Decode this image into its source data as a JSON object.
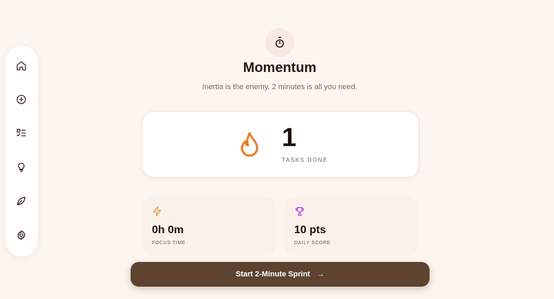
{
  "app": {
    "title": "Momentum",
    "subtitle": "Inertia is the enemy. 2 minutes is all you need."
  },
  "sidebar": {
    "items": [
      {
        "name": "home",
        "icon": "home-icon"
      },
      {
        "name": "add",
        "icon": "plus-circle-icon"
      },
      {
        "name": "tasks",
        "icon": "checklist-icon"
      },
      {
        "name": "ideas",
        "icon": "lightbulb-icon"
      },
      {
        "name": "growth",
        "icon": "leaf-icon"
      },
      {
        "name": "settings",
        "icon": "gear-icon"
      }
    ]
  },
  "tasks": {
    "count": "1",
    "label": "TASKS DONE",
    "icon": "flame-icon"
  },
  "stats": [
    {
      "value": "0h 0m",
      "label": "FOCUS TIME",
      "icon": "lightning-icon",
      "color": "#e0a14a"
    },
    {
      "value": "10 pts",
      "label": "DAILY SCORE",
      "icon": "trophy-icon",
      "color": "#b04adf"
    }
  ],
  "cta": {
    "label": "Start 2-Minute Sprint",
    "arrow": "→"
  },
  "colors": {
    "background": "#fdf5f0",
    "accent": "#5e4330",
    "flame": "#f07a1e"
  }
}
